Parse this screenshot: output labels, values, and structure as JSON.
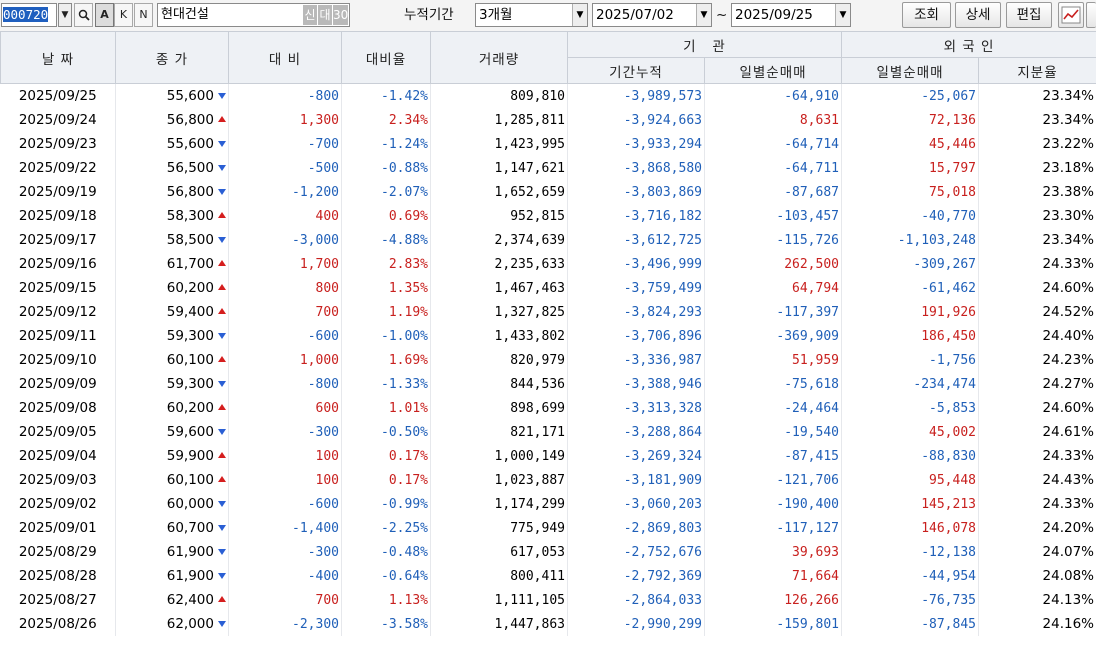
{
  "toolbar": {
    "code": "000720",
    "a_label": "A",
    "k_label": "K",
    "n_label": "N",
    "stock_name": "현대건설",
    "badge_sin": "신",
    "badge_dae": "대",
    "badge_num": "30",
    "period_label": "누적기간",
    "period_value": "3개월",
    "start_date": "2025/07/02",
    "tilde": "~",
    "end_date": "2025/09/25",
    "query_label": "조회",
    "detail_label": "상세",
    "edit_label": "편집"
  },
  "header": {
    "date": "날 짜",
    "close": "종 가",
    "change": "대 비",
    "change_rate": "대비율",
    "volume": "거래량",
    "institution": "기   관",
    "inst_cum": "기간누적",
    "inst_daily": "일별순매매",
    "foreign": "외 국 인",
    "foreign_daily": "일별순매매",
    "foreign_share": "지분율"
  },
  "rows": [
    {
      "date": "2025/09/25",
      "close": "55,600",
      "dir": "down",
      "change": "-800",
      "rate": "-1.42%",
      "volume": "809,810",
      "inst_cum": "-3,989,573",
      "inst_daily": "-64,910",
      "for_daily": "-25,067",
      "share": "23.34%"
    },
    {
      "date": "2025/09/24",
      "close": "56,800",
      "dir": "up",
      "change": "1,300",
      "rate": "2.34%",
      "volume": "1,285,811",
      "inst_cum": "-3,924,663",
      "inst_daily": "8,631",
      "for_daily": "72,136",
      "share": "23.34%"
    },
    {
      "date": "2025/09/23",
      "close": "55,600",
      "dir": "down",
      "change": "-700",
      "rate": "-1.24%",
      "volume": "1,423,995",
      "inst_cum": "-3,933,294",
      "inst_daily": "-64,714",
      "for_daily": "45,446",
      "share": "23.22%"
    },
    {
      "date": "2025/09/22",
      "close": "56,500",
      "dir": "down",
      "change": "-500",
      "rate": "-0.88%",
      "volume": "1,147,621",
      "inst_cum": "-3,868,580",
      "inst_daily": "-64,711",
      "for_daily": "15,797",
      "share": "23.18%"
    },
    {
      "date": "2025/09/19",
      "close": "56,800",
      "dir": "down",
      "change": "-1,200",
      "rate": "-2.07%",
      "volume": "1,652,659",
      "inst_cum": "-3,803,869",
      "inst_daily": "-87,687",
      "for_daily": "75,018",
      "share": "23.38%"
    },
    {
      "date": "2025/09/18",
      "close": "58,300",
      "dir": "up",
      "change": "400",
      "rate": "0.69%",
      "volume": "952,815",
      "inst_cum": "-3,716,182",
      "inst_daily": "-103,457",
      "for_daily": "-40,770",
      "share": "23.30%"
    },
    {
      "date": "2025/09/17",
      "close": "58,500",
      "dir": "down",
      "change": "-3,000",
      "rate": "-4.88%",
      "volume": "2,374,639",
      "inst_cum": "-3,612,725",
      "inst_daily": "-115,726",
      "for_daily": "-1,103,248",
      "share": "23.34%"
    },
    {
      "date": "2025/09/16",
      "close": "61,700",
      "dir": "up",
      "change": "1,700",
      "rate": "2.83%",
      "volume": "2,235,633",
      "inst_cum": "-3,496,999",
      "inst_daily": "262,500",
      "for_daily": "-309,267",
      "share": "24.33%"
    },
    {
      "date": "2025/09/15",
      "close": "60,200",
      "dir": "up",
      "change": "800",
      "rate": "1.35%",
      "volume": "1,467,463",
      "inst_cum": "-3,759,499",
      "inst_daily": "64,794",
      "for_daily": "-61,462",
      "share": "24.60%"
    },
    {
      "date": "2025/09/12",
      "close": "59,400",
      "dir": "up",
      "change": "700",
      "rate": "1.19%",
      "volume": "1,327,825",
      "inst_cum": "-3,824,293",
      "inst_daily": "-117,397",
      "for_daily": "191,926",
      "share": "24.52%"
    },
    {
      "date": "2025/09/11",
      "close": "59,300",
      "dir": "down",
      "change": "-600",
      "rate": "-1.00%",
      "volume": "1,433,802",
      "inst_cum": "-3,706,896",
      "inst_daily": "-369,909",
      "for_daily": "186,450",
      "share": "24.40%"
    },
    {
      "date": "2025/09/10",
      "close": "60,100",
      "dir": "up",
      "change": "1,000",
      "rate": "1.69%",
      "volume": "820,979",
      "inst_cum": "-3,336,987",
      "inst_daily": "51,959",
      "for_daily": "-1,756",
      "share": "24.23%"
    },
    {
      "date": "2025/09/09",
      "close": "59,300",
      "dir": "down",
      "change": "-800",
      "rate": "-1.33%",
      "volume": "844,536",
      "inst_cum": "-3,388,946",
      "inst_daily": "-75,618",
      "for_daily": "-234,474",
      "share": "24.27%"
    },
    {
      "date": "2025/09/08",
      "close": "60,200",
      "dir": "up",
      "change": "600",
      "rate": "1.01%",
      "volume": "898,699",
      "inst_cum": "-3,313,328",
      "inst_daily": "-24,464",
      "for_daily": "-5,853",
      "share": "24.60%"
    },
    {
      "date": "2025/09/05",
      "close": "59,600",
      "dir": "down",
      "change": "-300",
      "rate": "-0.50%",
      "volume": "821,171",
      "inst_cum": "-3,288,864",
      "inst_daily": "-19,540",
      "for_daily": "45,002",
      "share": "24.61%"
    },
    {
      "date": "2025/09/04",
      "close": "59,900",
      "dir": "up",
      "change": "100",
      "rate": "0.17%",
      "volume": "1,000,149",
      "inst_cum": "-3,269,324",
      "inst_daily": "-87,415",
      "for_daily": "-88,830",
      "share": "24.33%"
    },
    {
      "date": "2025/09/03",
      "close": "60,100",
      "dir": "up",
      "change": "100",
      "rate": "0.17%",
      "volume": "1,023,887",
      "inst_cum": "-3,181,909",
      "inst_daily": "-121,706",
      "for_daily": "95,448",
      "share": "24.43%"
    },
    {
      "date": "2025/09/02",
      "close": "60,000",
      "dir": "down",
      "change": "-600",
      "rate": "-0.99%",
      "volume": "1,174,299",
      "inst_cum": "-3,060,203",
      "inst_daily": "-190,400",
      "for_daily": "145,213",
      "share": "24.33%"
    },
    {
      "date": "2025/09/01",
      "close": "60,700",
      "dir": "down",
      "change": "-1,400",
      "rate": "-2.25%",
      "volume": "775,949",
      "inst_cum": "-2,869,803",
      "inst_daily": "-117,127",
      "for_daily": "146,078",
      "share": "24.20%"
    },
    {
      "date": "2025/08/29",
      "close": "61,900",
      "dir": "down",
      "change": "-300",
      "rate": "-0.48%",
      "volume": "617,053",
      "inst_cum": "-2,752,676",
      "inst_daily": "39,693",
      "for_daily": "-12,138",
      "share": "24.07%"
    },
    {
      "date": "2025/08/28",
      "close": "61,900",
      "dir": "down",
      "change": "-400",
      "rate": "-0.64%",
      "volume": "800,411",
      "inst_cum": "-2,792,369",
      "inst_daily": "71,664",
      "for_daily": "-44,954",
      "share": "24.08%"
    },
    {
      "date": "2025/08/27",
      "close": "62,400",
      "dir": "up",
      "change": "700",
      "rate": "1.13%",
      "volume": "1,111,105",
      "inst_cum": "-2,864,033",
      "inst_daily": "126,266",
      "for_daily": "-76,735",
      "share": "24.13%"
    },
    {
      "date": "2025/08/26",
      "close": "62,000",
      "dir": "down",
      "change": "-2,300",
      "rate": "-3.58%",
      "volume": "1,447,863",
      "inst_cum": "-2,990,299",
      "inst_daily": "-159,801",
      "for_daily": "-87,845",
      "share": "24.16%"
    }
  ],
  "colors": {
    "up": "#c8201e",
    "down": "#1f5fb8",
    "header_bg": "#eef1f5",
    "selection": "#1f5fbf"
  }
}
